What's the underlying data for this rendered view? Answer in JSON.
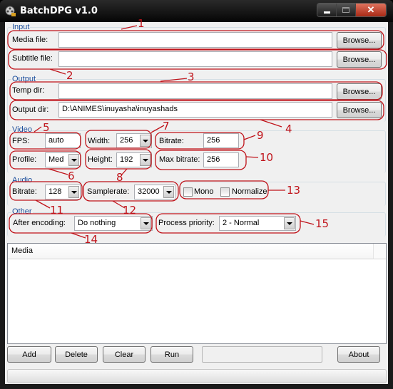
{
  "window": {
    "title": "BatchDPG v1.0",
    "app_icon": "film-reel-icon",
    "controls": {
      "minimize": "minimize-icon",
      "maximize": "maximize-icon",
      "close": "close-icon"
    }
  },
  "input_group": {
    "label": "Input",
    "media_file": {
      "label": "Media file:",
      "value": "",
      "browse": "Browse..."
    },
    "subtitle_file": {
      "label": "Subtitle file:",
      "value": "",
      "browse": "Browse..."
    }
  },
  "output_group": {
    "label": "Output",
    "temp_dir": {
      "label": "Temp dir:",
      "value": "",
      "browse": "Browse..."
    },
    "output_dir": {
      "label": "Output dir:",
      "value": "D:\\ANIMES\\inuyasha\\inuyashads",
      "browse": "Browse..."
    }
  },
  "video_group": {
    "label": "Video",
    "fps": {
      "label": "FPS:",
      "value": "auto"
    },
    "profile": {
      "label": "Profile:",
      "value": "Med"
    },
    "width": {
      "label": "Width:",
      "value": "256"
    },
    "height": {
      "label": "Height:",
      "value": "192"
    },
    "bitrate": {
      "label": "Bitrate:",
      "value": "256"
    },
    "max_bitrate": {
      "label": "Max bitrate:",
      "value": "256"
    }
  },
  "audio_group": {
    "label": "Audio",
    "bitrate": {
      "label": "Bitrate:",
      "value": "128"
    },
    "samplerate": {
      "label": "Samplerate:",
      "value": "32000"
    },
    "mono": {
      "label": "Mono",
      "checked": false
    },
    "normalize": {
      "label": "Normalize",
      "checked": false
    }
  },
  "other_group": {
    "label": "Other",
    "after_encoding": {
      "label": "After encoding:",
      "value": "Do nothing"
    },
    "process_priority": {
      "label": "Process priority:",
      "value": "2 - Normal"
    }
  },
  "media_list": {
    "column_header": "Media",
    "items": []
  },
  "buttons": {
    "add": "Add",
    "delete": "Delete",
    "clear": "Clear",
    "run": "Run",
    "about": "About"
  },
  "annotations": {
    "color": "#c0131a",
    "numbers": [
      "1",
      "2",
      "3",
      "4",
      "5",
      "6",
      "7",
      "8",
      "9",
      "10",
      "11",
      "12",
      "13",
      "14",
      "15"
    ]
  }
}
